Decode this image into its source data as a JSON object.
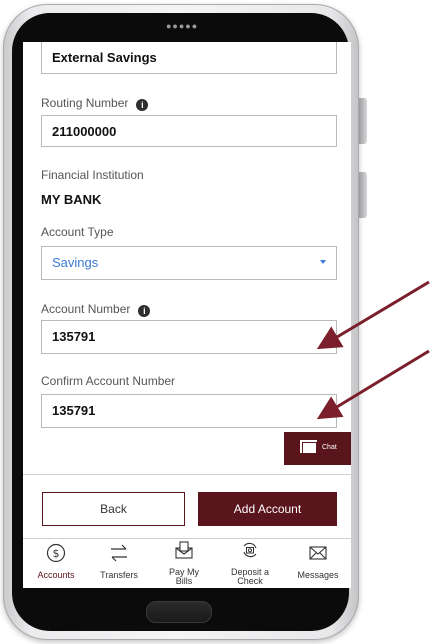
{
  "form": {
    "nickname_value": "External Savings",
    "routing_label": "Routing Number",
    "routing_value": "211000000",
    "institution_label": "Financial Institution",
    "institution_value": "MY BANK",
    "account_type_label": "Account Type",
    "account_type_value": "Savings",
    "account_number_label": "Account Number",
    "account_number_value": "135791",
    "confirm_label": "Confirm Account Number",
    "confirm_value": "135791"
  },
  "chat": {
    "label": "Chat"
  },
  "buttons": {
    "back": "Back",
    "add": "Add Account"
  },
  "nav": {
    "items": [
      {
        "label": "Accounts",
        "icon": "dollar-circle-icon"
      },
      {
        "label": "Transfers",
        "icon": "transfer-arrows-icon"
      },
      {
        "label": "Pay My Bills",
        "icon": "bill-envelope-icon"
      },
      {
        "label": "Deposit a Check",
        "icon": "camera-check-icon"
      },
      {
        "label": "Messages",
        "icon": "mail-icon"
      }
    ]
  },
  "colors": {
    "brand": "#5a141c",
    "link": "#3d7ad6",
    "annotation_arrow": "#7a1f2b"
  },
  "status": {
    "dots": "●●●●●"
  }
}
